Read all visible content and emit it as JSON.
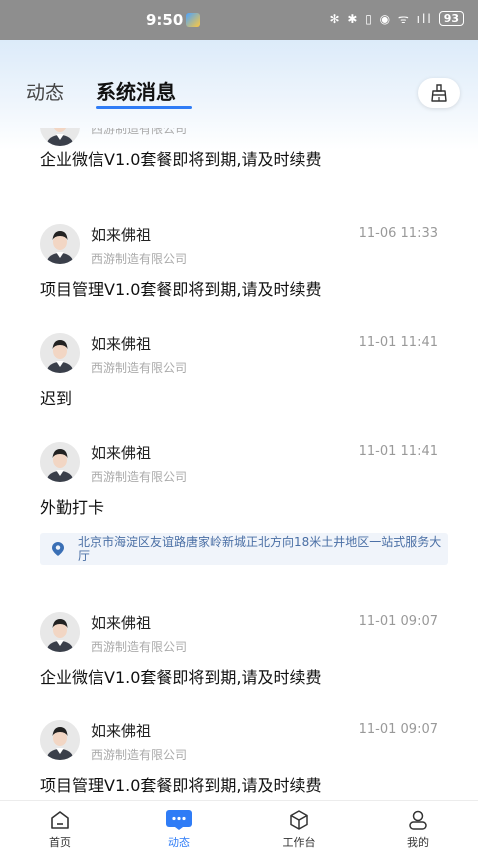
{
  "status_bar": {
    "time": "9:50",
    "icons": "✻ ✱ ▯ ◉ ᯤ ıll",
    "battery": "93"
  },
  "header": {
    "tabs": [
      {
        "label": "动态",
        "active": false
      },
      {
        "label": "系统消息",
        "active": true
      }
    ],
    "accent_color": "#2f7cf6",
    "clear_icon": "broom-icon"
  },
  "messages": [
    {
      "sender": "如来佛祖",
      "company": "西游制造有限公司",
      "time": "",
      "content": "企业微信V1.0套餐即将到期,请及时续费"
    },
    {
      "sender": "如来佛祖",
      "company": "西游制造有限公司",
      "time": "11-06 11:33",
      "content": "项目管理V1.0套餐即将到期,请及时续费"
    },
    {
      "sender": "如来佛祖",
      "company": "西游制造有限公司",
      "time": "11-01 11:41",
      "content": "迟到"
    },
    {
      "sender": "如来佛祖",
      "company": "西游制造有限公司",
      "time": "11-01 11:41",
      "content": "外勤打卡",
      "location": "北京市海淀区友谊路唐家岭新城正北方向18米土井地区一站式服务大厅"
    },
    {
      "sender": "如来佛祖",
      "company": "西游制造有限公司",
      "time": "11-01 09:07",
      "content": "企业微信V1.0套餐即将到期,请及时续费"
    },
    {
      "sender": "如来佛祖",
      "company": "西游制造有限公司",
      "time": "11-01 09:07",
      "content": "项目管理V1.0套餐即将到期,请及时续费"
    }
  ],
  "bottom_nav": [
    {
      "label": "首页",
      "icon": "home-icon",
      "active": false
    },
    {
      "label": "动态",
      "icon": "chat-bubble-icon",
      "active": true
    },
    {
      "label": "工作台",
      "icon": "cube-icon",
      "active": false
    },
    {
      "label": "我的",
      "icon": "person-icon",
      "active": false
    }
  ]
}
